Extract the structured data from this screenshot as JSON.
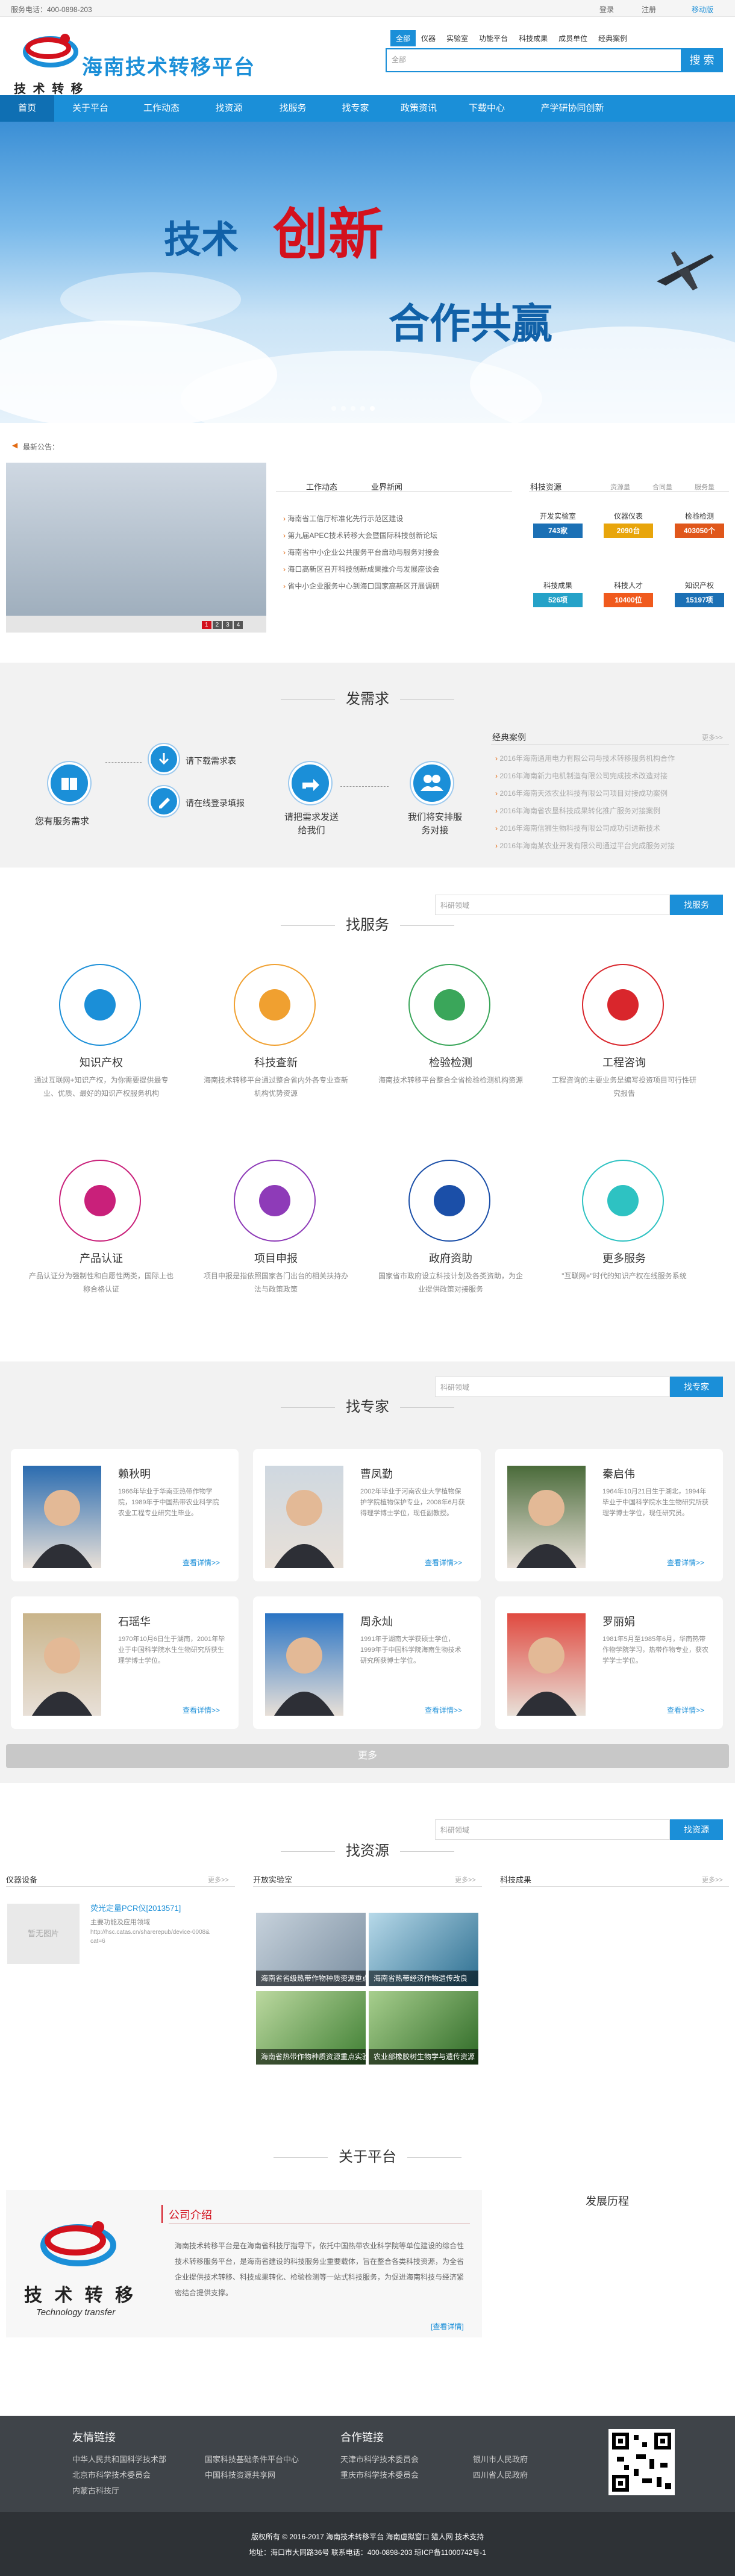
{
  "topbar": {
    "phone": "服务电话：400-0898-203",
    "login": "登录",
    "register": "注册",
    "mobile": "移动版"
  },
  "header": {
    "title": "海南技术转移平台",
    "logo_cn": "技 术 转 移",
    "logo_en": "Technology transfer",
    "search_tabs": [
      "全部",
      "仪器",
      "实验室",
      "功能平台",
      "科技成果",
      "成员单位",
      "经典案例"
    ],
    "search_placeholder": "全部",
    "search_button": "搜 索"
  },
  "nav": [
    "首页",
    "关于平台",
    "工作动态",
    "找资源",
    "找服务",
    "找专家",
    "政策资讯",
    "下载中心",
    "产学研协同创新"
  ],
  "banner": {
    "t1": "技术",
    "t2": "创新",
    "t3": "合作共赢"
  },
  "notice": {
    "label": "最新公告："
  },
  "news": {
    "tabs": [
      "工作动态",
      "业界新闻"
    ],
    "items": [
      "海南省工信厅标准化先行示范区建设",
      "第九届APEC技术转移大会暨国际科技创新论坛",
      "海南省中小企业公共服务平台启动与服务对接会",
      "海口高新区召开科技创新成果推介与发展座谈会",
      "省中小企业服务中心到海口国家高新区开展调研"
    ],
    "pages": [
      "1",
      "2",
      "3",
      "4"
    ]
  },
  "resources": {
    "title": "科技资源",
    "tabs": [
      "资源量",
      "合同量",
      "服务量"
    ],
    "boxes": [
      {
        "label": "开发实验室",
        "value": "743家",
        "color": "#1b70b5"
      },
      {
        "label": "仪器仪表",
        "value": "2090台",
        "color": "#e8a50b"
      },
      {
        "label": "检验检测",
        "value": "403050个",
        "color": "#e0571b"
      },
      {
        "label": "科技成果",
        "value": "526项",
        "color": "#25a2c8"
      },
      {
        "label": "科技人才",
        "value": "10400位",
        "color": "#f05a1d"
      },
      {
        "label": "知识产权",
        "value": "15197项",
        "color": "#1b70b5"
      }
    ]
  },
  "demand": {
    "title": "发需求",
    "left": "您有服务需求",
    "steps": [
      "请下载需求表",
      "请在线登录填报",
      "请把需求发送给我们",
      "我们将安排服务对接"
    ],
    "cases_title": "经典案例",
    "more": "更多>>",
    "cases": [
      "2016年海南通用电力有限公司与技术转移服务机构合作",
      "2016年海南新力电机制造有限公司完成技术改造对接",
      "2016年海南天浓农业科技有限公司项目对接成功案例",
      "2016年海南省农垦科技成果转化推广服务对接案例",
      "2016年海南信狮生物科技有限公司成功引进新技术",
      "2016年海南某农业开发有限公司通过平台完成服务对接"
    ]
  },
  "services": {
    "title": "找服务",
    "search_placeholder": "科研领域",
    "search_button": "找服务",
    "items": [
      {
        "title": "知识产权",
        "desc": "通过互联网+知识产权，为你需要提供最专业、优质、最好的知识产权服务机构",
        "color": "#1b8fd8"
      },
      {
        "title": "科技查新",
        "desc": "海南技术转移平台通过整合省内外各专业查新机构优势资源",
        "color": "#f0a030"
      },
      {
        "title": "检验检测",
        "desc": "海南技术转移平台整合全省检验检测机构资源",
        "color": "#3aa65a"
      },
      {
        "title": "工程咨询",
        "desc": "工程咨询的主要业务是编写投资项目可行性研究报告",
        "color": "#d9262c"
      },
      {
        "title": "产品认证",
        "desc": "产品认证分为强制性和自愿性两类，国际上也称合格认证",
        "color": "#c9207a"
      },
      {
        "title": "项目申报",
        "desc": "项目申报是指依照国家各门出台的相关扶持办法与政策政策",
        "color": "#8e3bb8"
      },
      {
        "title": "政府资助",
        "desc": "国家省市政府设立科技计划及各类资助，为企业提供政策对接服务",
        "color": "#1b4fa8"
      },
      {
        "title": "更多服务",
        "desc": "\"互联网+\"时代的知识产权在线服务系统",
        "color": "#2ec2c2"
      }
    ]
  },
  "experts": {
    "title": "找专家",
    "search_placeholder": "科研领域",
    "search_button": "找专家",
    "more_button": "更多",
    "items": [
      {
        "name": "赖秋明",
        "desc": "1966年毕业于华南亚热带作物学院，1989年于中国热带农业科学院农业工程专业研究生毕业。",
        "more": "查看详情>>"
      },
      {
        "name": "曹凤勤",
        "desc": "2002年毕业于河南农业大学植物保护学院植物保护专业，2008年6月获得理学博士学位，现任副教授。",
        "more": "查看详情>>"
      },
      {
        "name": "秦启伟",
        "desc": "1964年10月21日生于湖北，1994年毕业于中国科学院水生生物研究所获理学博士学位，现任研究员。",
        "more": "查看详情>>"
      },
      {
        "name": "石瑶华",
        "desc": "1970年10月6日生于湖南，2001年毕业于中国科学院水生生物研究所获生理学博士学位。",
        "more": "查看详情>>"
      },
      {
        "name": "周永灿",
        "desc": "1991年于湖南大学获硕士学位，1999年于中国科学院海南生物技术研究所获博士学位。",
        "more": "查看详情>>"
      },
      {
        "name": "罗丽娟",
        "desc": "1981年5月至1985年6月，华南热带作物学院学习，热带作物专业，获农学学士学位。",
        "more": "查看详情>>"
      }
    ]
  },
  "find_res": {
    "title": "找资源",
    "search_placeholder": "科研领域",
    "search_button": "找资源",
    "cols": [
      "仪器设备",
      "开放实验室",
      "科技成果"
    ],
    "more": "更多>>",
    "instrument": {
      "name": "荧光定量PCR仪[2013571]",
      "line1": "主要功能及应用领域",
      "line2": "http://hsc.catas.cn/sharerepub/device-0008&cat=6",
      "img_text": "暂无图片"
    },
    "labs": [
      "海南省省级热带作物种质资源重点实验室",
      "海南省热带经济作物遗传改良",
      "海南省热带作物种质资源重点实验室",
      "农业部橡胶树生物学与遗传资源"
    ]
  },
  "about": {
    "title": "关于平台",
    "intro_title": "公司介绍",
    "history_title": "发展历程",
    "text": "海南技术转移平台是在海南省科技厅指导下，依托中国热带农业科学院等单位建设的综合性技术转移服务平台，是海南省建设的科技服务业重要载体，旨在整合各类科技资源，为全省企业提供技术转移、科技成果转化、检验检测等一站式科技服务，为促进海南科技与经济紧密结合提供支撑。",
    "more": "[查看详情]"
  },
  "footer": {
    "friend_title": "友情链接",
    "friend_links": [
      "中华人民共和国科学技术部",
      "国家科技基础条件平台中心",
      "北京市科学技术委员会",
      "中国科技资源共享网",
      "内蒙古科技厅"
    ],
    "partner_title": "合作链接",
    "partner_links": [
      "天津市科学技术委员会",
      "银川市人民政府",
      "重庆市科学技术委员会",
      "四川省人民政府"
    ],
    "copyright": "版权所有 © 2016-2017 海南技术转移平台  海南虚拟窗口  猎人网  技术支持",
    "address": "地址：海口市大同路36号  联系电话：400-0898-203  琼ICP备11000742号-1"
  }
}
